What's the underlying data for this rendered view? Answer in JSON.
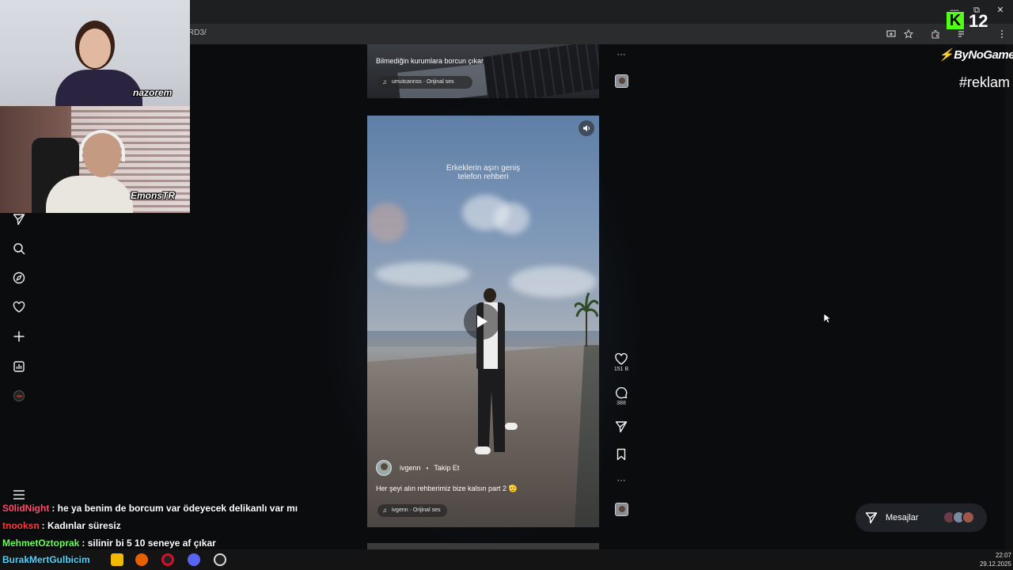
{
  "browser": {
    "url": "RD3/",
    "window_controls": [
      "—",
      "⧉",
      "✕"
    ]
  },
  "feed": {
    "top_reel": {
      "caption": "Bilmediğin kurumlara borcun çıkar",
      "audio": "umutcannss · Orijinal ses"
    },
    "main_reel": {
      "overlay_text_line1": "Erkeklerin aşırı geniş",
      "overlay_text_line2": "telefon rehberi",
      "author": "ivgenn",
      "dot": "•",
      "follow": "Takip Et",
      "caption": "Her şeyi alın rehberimiz bize kalsın part 2 🫡",
      "audio": "ivgenn · Orijinal ses"
    }
  },
  "actions": {
    "more_icon": "···",
    "likes": "151 B",
    "comments": "388"
  },
  "messages": {
    "label": "Mesajlar"
  },
  "stream": {
    "cam1_name": "nazorem",
    "cam2_name": "EmonsTR",
    "viewer_count": "12",
    "kick_letter": "K",
    "sponsor": "ByNoGame",
    "hashtag": "#reklam"
  },
  "chat": [
    {
      "user": "S0lidNight",
      "message": ": he ya benim de borcum var ödeyecek delikanlı var mı",
      "color": "#ff4d6d"
    },
    {
      "user": "tnooksn",
      "message": ": Kadınlar süresiz",
      "color": "#ff3b3b"
    },
    {
      "user": "MehmetOztoprak",
      "message": ": silinir bi 5 10 seneye af çıkar",
      "color": "#6cff5a"
    },
    {
      "user": "BurakMertGulbicim",
      "message": "",
      "color": "#4fd6ff"
    }
  ],
  "clock": {
    "time": "22:07",
    "date": "29.12.2025"
  },
  "colors": {
    "page_bg": "#0a0c0e",
    "kick_green": "#53fc18",
    "sponsor_red": "#e63030"
  }
}
